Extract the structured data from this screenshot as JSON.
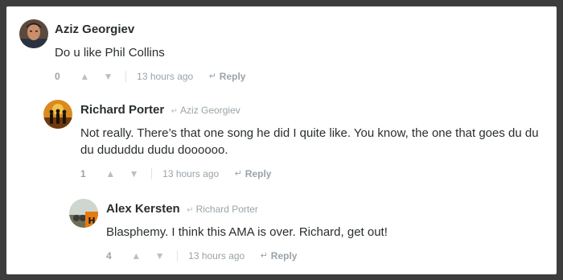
{
  "comments": [
    {
      "author": "Aziz Georgiev",
      "reply_to": "",
      "text": "Do u like Phil Collins",
      "votes": "0",
      "time": "13 hours ago",
      "reply_label": "Reply"
    },
    {
      "author": "Richard Porter",
      "reply_to": "Aziz Georgiev",
      "text": "Not really. There’s that one song he did I quite like. You know, the one that goes du du du dududdu dudu doooooo.",
      "votes": "1",
      "time": "13 hours ago",
      "reply_label": "Reply"
    },
    {
      "author": "Alex Kersten",
      "reply_to": "Richard Porter",
      "text": "Blasphemy. I think this AMA is over. Richard, get out!",
      "votes": "4",
      "time": "13 hours ago",
      "reply_label": "Reply"
    }
  ],
  "icons": {
    "upvote": "▲",
    "downvote": "▼",
    "reply_arrow": "↵",
    "reply_to_arrow": "↵"
  },
  "colors": {
    "page_bg": "#3d3d3d",
    "card_bg": "#ffffff",
    "author": "#2a2e2e",
    "muted": "#9aa3a8"
  }
}
